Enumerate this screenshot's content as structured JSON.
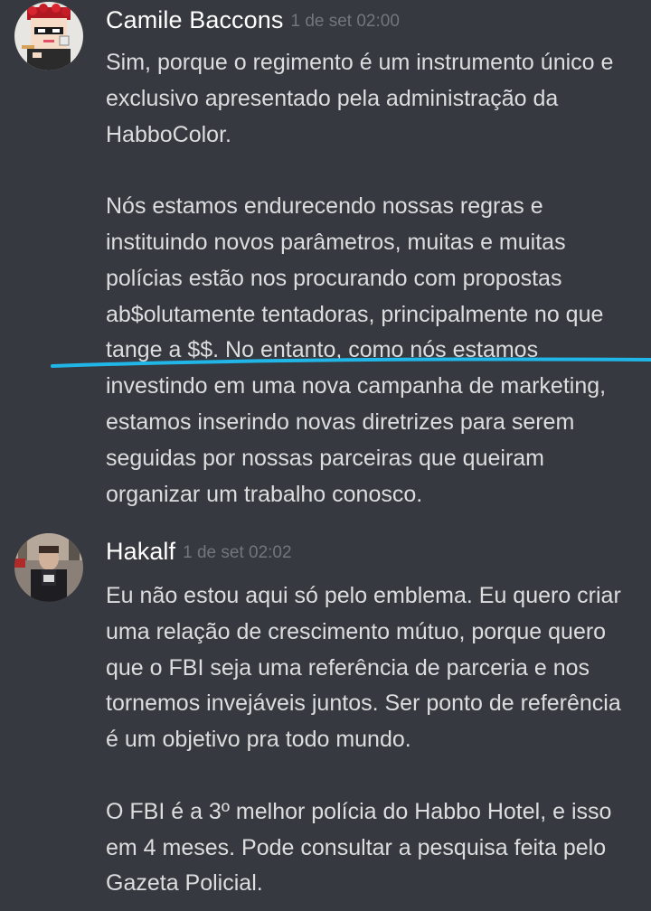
{
  "messages": [
    {
      "author": "Camile Baccons",
      "timestamp": "1 de set 02:00",
      "avatar_icon": "pixel-character-avatar-icon",
      "paragraphs": [
        "Sim, porque o regimento é um instrumento único e exclusivo apresentado pela administração da HabboColor.",
        "Nós estamos endurecendo nossas regras e instituindo novos parâmetros, muitas e muitas polícias estão nos procurando com propostas ab$olutamente tentadoras, principalmente no que tange a $$. No entanto, como nós estamos investindo em uma nova campanha de marketing, estamos inserindo novas diretrizes para serem seguidas por nossas parceiras que queiram organizar um trabalho conosco."
      ]
    },
    {
      "author": "Hakalf",
      "timestamp": "1 de set 02:02",
      "avatar_icon": "person-photo-avatar-icon",
      "paragraphs": [
        "Eu não estou aqui só pelo emblema. Eu quero criar uma relação de crescimento mútuo, porque quero que o FBI seja uma referência de parceria e nos tornemos invejáveis juntos. Ser ponto de referência é um objetivo pra todo mundo.",
        "O FBI é a 3º melhor polícia do Habbo Hotel, e isso em 4 meses. Pode consultar a pesquisa feita pelo Gazeta Policial."
      ]
    }
  ],
  "colors": {
    "background": "#36393f",
    "text": "#dcddde",
    "author": "#ffffff",
    "timestamp": "#72767d",
    "highlight_stroke": "#21b6e8"
  }
}
